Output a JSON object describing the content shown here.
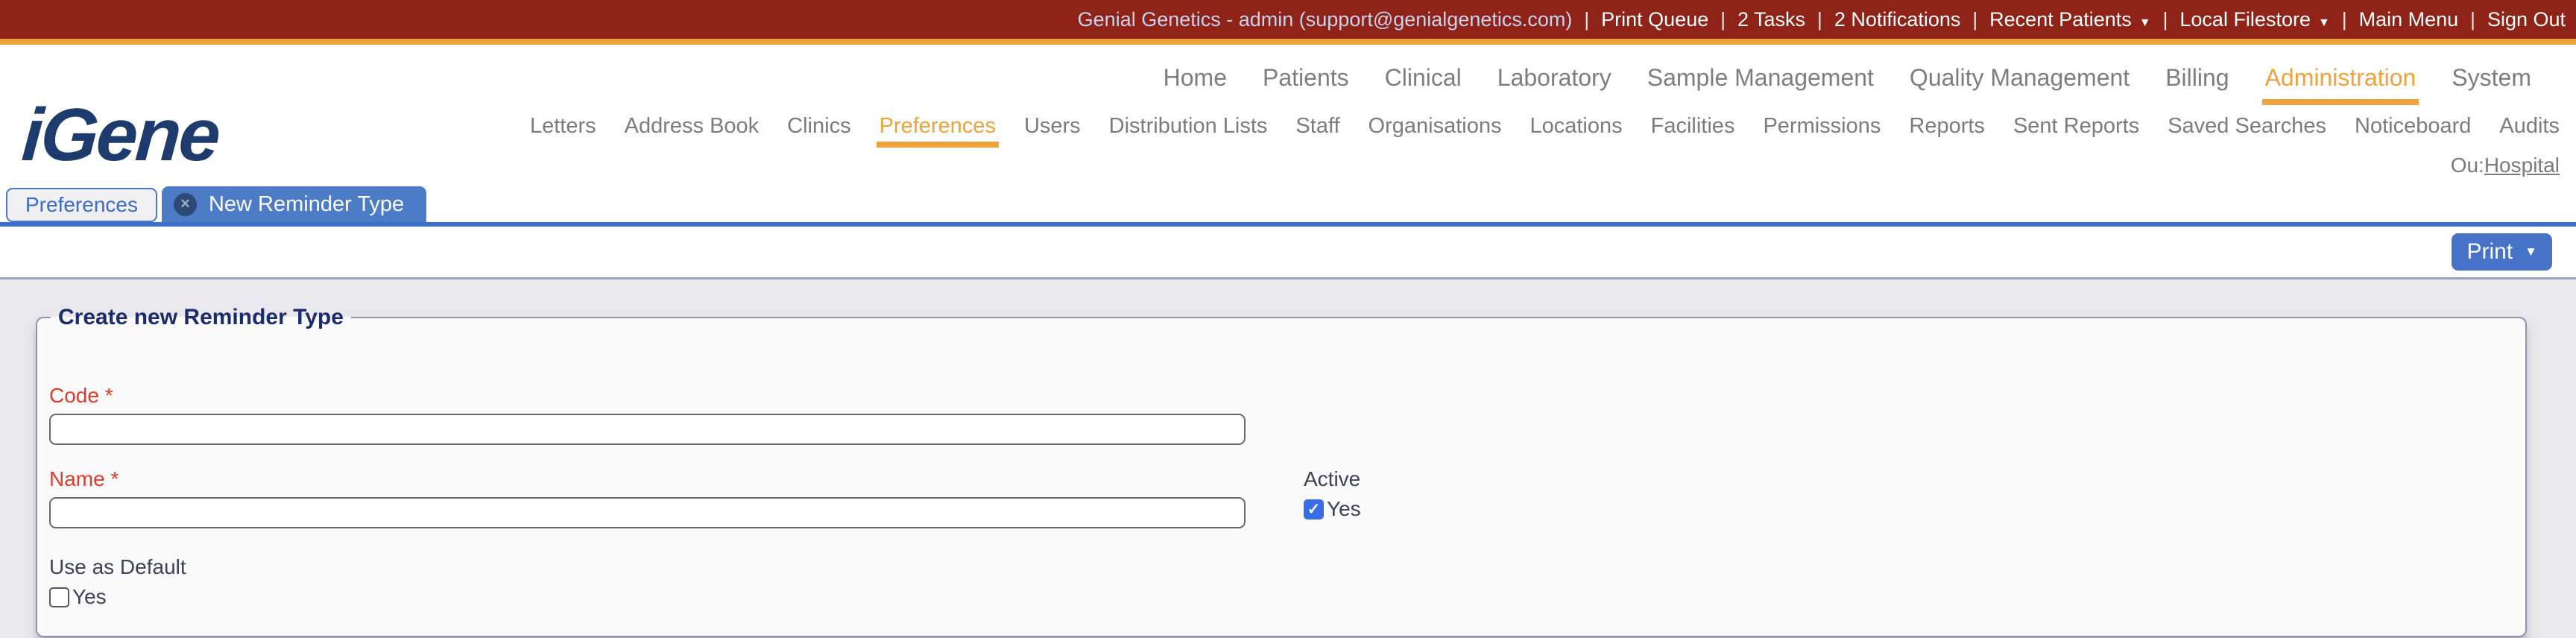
{
  "topbar": {
    "user_info": "Genial Genetics - admin (support@genialgenetics.com)",
    "separator": "|",
    "print_queue": "Print Queue",
    "tasks": "2 Tasks",
    "notifications": "2 Notifications",
    "recent_patients": "Recent Patients",
    "local_filestore": "Local Filestore",
    "main_menu": "Main Menu",
    "sign_out": "Sign Out",
    "caret": "▼"
  },
  "branding": {
    "logo": "iGene"
  },
  "main_nav": {
    "items": [
      "Home",
      "Patients",
      "Clinical",
      "Laboratory",
      "Sample Management",
      "Quality Management",
      "Billing",
      "Administration",
      "System"
    ],
    "active": "Administration"
  },
  "sub_nav": {
    "items": [
      "Letters",
      "Address Book",
      "Clinics",
      "Preferences",
      "Users",
      "Distribution Lists",
      "Staff",
      "Organisations",
      "Locations",
      "Facilities",
      "Permissions",
      "Reports",
      "Sent Reports",
      "Saved Searches",
      "Noticeboard",
      "Audits"
    ],
    "active": "Preferences"
  },
  "org_unit": {
    "label": "Ou:",
    "value": "Hospital"
  },
  "tabs": [
    {
      "label": "Preferences",
      "active": false
    },
    {
      "label": "New Reminder Type",
      "active": true,
      "close_glyph": "✕"
    }
  ],
  "toolbar": {
    "print": "Print",
    "caret": "▼"
  },
  "form": {
    "legend": "Create new Reminder Type",
    "required_marker": "*",
    "code_label": "Code",
    "code_value": "",
    "name_label": "Name",
    "name_value": "",
    "active_label": "Active",
    "active_option": "Yes",
    "active_checked": true,
    "default_label": "Use as Default",
    "default_option": "Yes",
    "default_checked": false,
    "check_glyph": "✓"
  },
  "colors": {
    "topbar_red": "#8f2318",
    "accent_gold": "#eda43c",
    "nav_active_orange": "#f0a23c",
    "tab_blue": "#4d7cc7",
    "tab_line_blue": "#3c70c8",
    "button_blue": "#4673c8",
    "checkbox_blue": "#3a6ce8",
    "required_red": "#e23b2e",
    "logo_navy": "#1d3c6d",
    "legend_navy": "#1b2c6a"
  }
}
